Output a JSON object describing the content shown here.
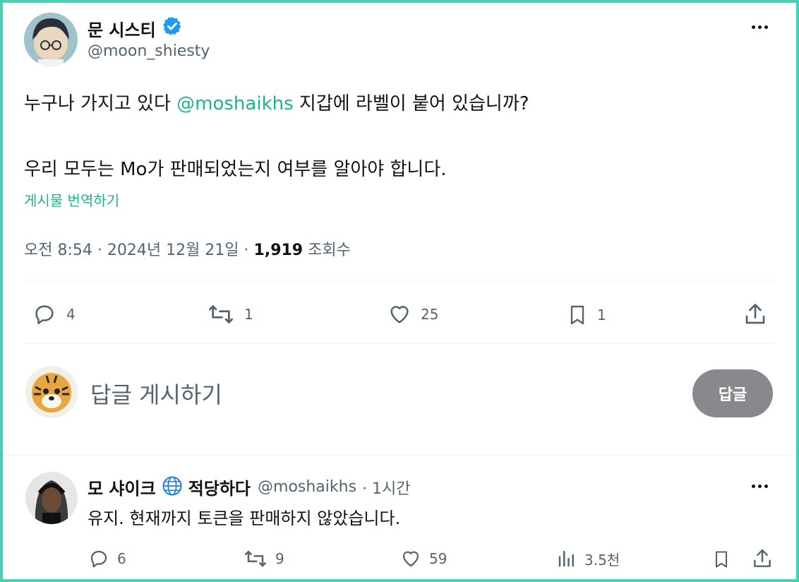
{
  "tweet": {
    "author_name": "문 시스티",
    "author_handle": "@moon_shiesty",
    "text_line1_before": "누구나 가지고 있다 ",
    "text_line1_mention": "@moshaikhs",
    "text_line1_after": " 지갑에 라벨이 붙어 있습니까?",
    "text_line2": "우리 모두는 Mo가 판매되었는지 여부를 알아야 합니다.",
    "translate_label": "게시물 번역하기",
    "timestamp": "오전 8:54 · 2024년 12월 21일 · ",
    "views_count": "1,919",
    "views_label": " 조회수",
    "replies": "4",
    "retweets": "1",
    "likes": "25",
    "bookmarks": "1"
  },
  "composer": {
    "placeholder": "답글 게시하기",
    "button_label": "답글"
  },
  "reply": {
    "author_name": "모 샤이크",
    "author_suffix": "적당하다",
    "author_handle": "@moshaikhs",
    "time": " · 1시간",
    "text": "유지. 현재까지 토큰을 판매하지 않았습니다.",
    "replies": "6",
    "retweets": "9",
    "likes": "59",
    "views": "3.5천"
  },
  "colors": {
    "accent": "#1db48a",
    "verified": "#1d9bf0",
    "frame": "#42d3b6",
    "muted": "#536471"
  }
}
